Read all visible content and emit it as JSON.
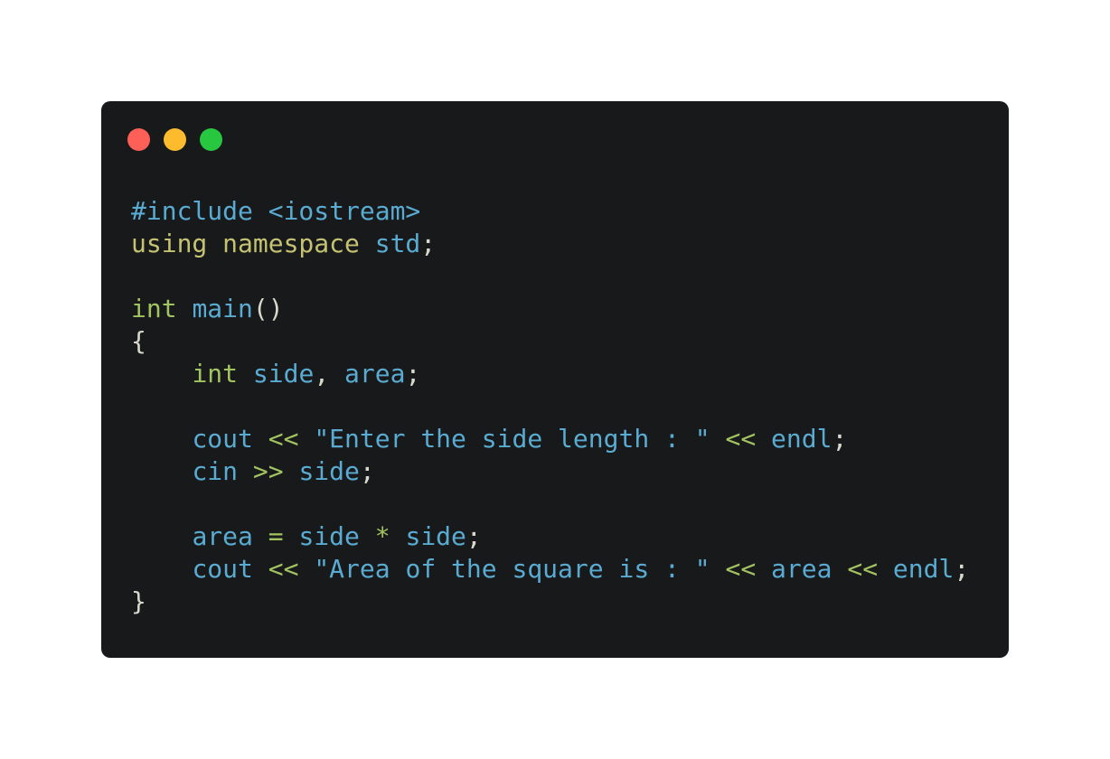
{
  "window": {
    "controls": [
      {
        "name": "close",
        "color": "#fe5f57"
      },
      {
        "name": "minimize",
        "color": "#febb2e"
      },
      {
        "name": "maximize",
        "color": "#27c840"
      }
    ]
  },
  "theme": {
    "background": "#18191b",
    "page_background": "#ffffff",
    "colors": {
      "keyword": "#c5c371",
      "type": "#a2c460",
      "identifier": "#5aabd1",
      "operator": "#a2c460",
      "punct": "#d8d8cc"
    }
  },
  "code": {
    "lines": [
      [
        {
          "t": "#include <iostream>",
          "c": "identifier"
        }
      ],
      [
        {
          "t": "using namespace ",
          "c": "keyword"
        },
        {
          "t": "std",
          "c": "identifier"
        },
        {
          "t": ";",
          "c": "punct"
        }
      ],
      [],
      [
        {
          "t": "int ",
          "c": "type"
        },
        {
          "t": "main",
          "c": "identifier"
        },
        {
          "t": "()",
          "c": "punct"
        }
      ],
      [
        {
          "t": "{",
          "c": "punct"
        }
      ],
      [
        {
          "t": "    ",
          "c": "punct"
        },
        {
          "t": "int ",
          "c": "type"
        },
        {
          "t": "side",
          "c": "identifier"
        },
        {
          "t": ", ",
          "c": "punct"
        },
        {
          "t": "area",
          "c": "identifier"
        },
        {
          "t": ";",
          "c": "punct"
        }
      ],
      [],
      [
        {
          "t": "    ",
          "c": "punct"
        },
        {
          "t": "cout ",
          "c": "identifier"
        },
        {
          "t": "<< ",
          "c": "operator"
        },
        {
          "t": "\"Enter the side length : \" ",
          "c": "identifier"
        },
        {
          "t": "<< ",
          "c": "operator"
        },
        {
          "t": "endl",
          "c": "identifier"
        },
        {
          "t": ";",
          "c": "punct"
        }
      ],
      [
        {
          "t": "    ",
          "c": "punct"
        },
        {
          "t": "cin ",
          "c": "identifier"
        },
        {
          "t": ">> ",
          "c": "operator"
        },
        {
          "t": "side",
          "c": "identifier"
        },
        {
          "t": ";",
          "c": "punct"
        }
      ],
      [],
      [
        {
          "t": "    ",
          "c": "punct"
        },
        {
          "t": "area ",
          "c": "identifier"
        },
        {
          "t": "= ",
          "c": "operator"
        },
        {
          "t": "side ",
          "c": "identifier"
        },
        {
          "t": "* ",
          "c": "operator"
        },
        {
          "t": "side",
          "c": "identifier"
        },
        {
          "t": ";",
          "c": "punct"
        }
      ],
      [
        {
          "t": "    ",
          "c": "punct"
        },
        {
          "t": "cout ",
          "c": "identifier"
        },
        {
          "t": "<< ",
          "c": "operator"
        },
        {
          "t": "\"Area of the square is : \" ",
          "c": "identifier"
        },
        {
          "t": "<< ",
          "c": "operator"
        },
        {
          "t": "area ",
          "c": "identifier"
        },
        {
          "t": "<< ",
          "c": "operator"
        },
        {
          "t": "endl",
          "c": "identifier"
        },
        {
          "t": ";",
          "c": "punct"
        }
      ],
      [
        {
          "t": "}",
          "c": "punct"
        }
      ]
    ]
  }
}
